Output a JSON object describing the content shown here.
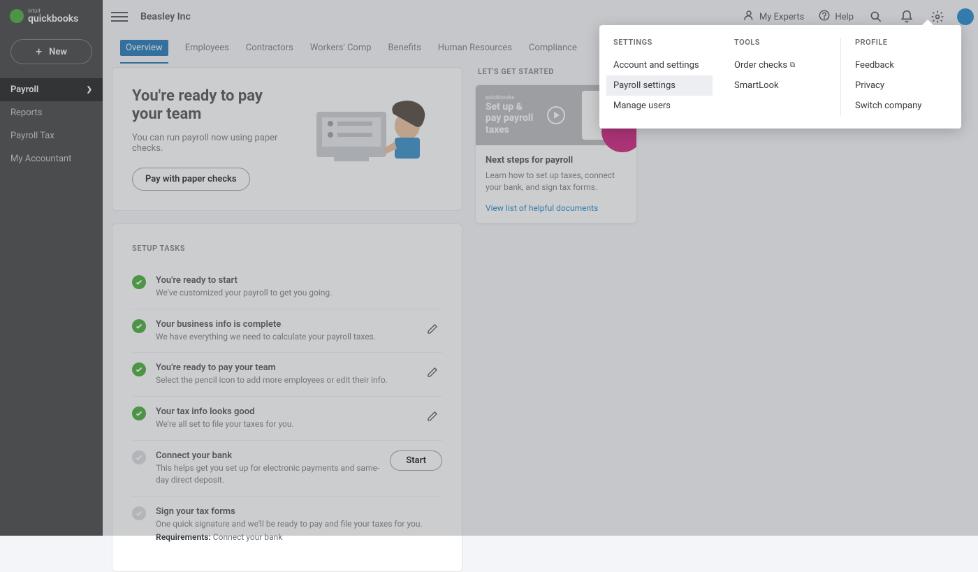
{
  "brand": {
    "main": "quickbooks",
    "sub": "intuit"
  },
  "sidebar": {
    "new_label": "New",
    "items": [
      {
        "label": "Payroll",
        "active": true,
        "has_chevron": true
      },
      {
        "label": "Reports"
      },
      {
        "label": "Payroll Tax"
      },
      {
        "label": "My Accountant"
      }
    ]
  },
  "topbar": {
    "company": "Beasley Inc",
    "experts": "My Experts",
    "help": "Help"
  },
  "tabs": [
    "Overview",
    "Employees",
    "Contractors",
    "Workers' Comp",
    "Benefits",
    "Human Resources",
    "Compliance"
  ],
  "hero": {
    "title_line1": "You're ready to pay",
    "title_line2": "your team",
    "subtitle": "You can run payroll now using paper checks.",
    "button": "Pay with paper checks"
  },
  "setup": {
    "header": "SETUP TASKS",
    "tasks": [
      {
        "done": true,
        "title": "You're ready to start",
        "desc": "We've customized your payroll to get you going.",
        "action": null
      },
      {
        "done": true,
        "title": "Your business info is complete",
        "desc": "We have everything we need to calculate your payroll taxes.",
        "action": "edit"
      },
      {
        "done": true,
        "title": "You're ready to pay your team",
        "desc": "Select the pencil icon to add more employees or edit their info.",
        "action": "edit"
      },
      {
        "done": true,
        "title": "Your tax info looks good",
        "desc": "We're all set to file your taxes for you.",
        "action": "edit"
      },
      {
        "done": false,
        "title": "Connect your bank",
        "desc": "This helps get you set up for electronic payments and same-day direct deposit.",
        "action": "start"
      },
      {
        "done": false,
        "title": "Sign your tax forms",
        "desc": "One quick signature and we'll be ready to pay and file your taxes for you.",
        "action": null,
        "req_label": "Requirements:",
        "req_text": "Connect your bank"
      }
    ],
    "start_label": "Start"
  },
  "getstarted": {
    "header": "LET'S GET STARTED",
    "thumb_brand": "quickbooks",
    "thumb_line1": "Set up &",
    "thumb_line2": "pay payroll",
    "thumb_line3": "taxes",
    "title": "Next steps for payroll",
    "desc": "Learn how to set up taxes, connect your bank, and sign tax forms.",
    "link": "View list of helpful documents"
  },
  "popover": {
    "columns": [
      {
        "header": "SETTINGS",
        "items": [
          {
            "label": "Account and settings"
          },
          {
            "label": "Payroll settings",
            "highlighted": true
          },
          {
            "label": "Manage users"
          }
        ]
      },
      {
        "header": "TOOLS",
        "items": [
          {
            "label": "Order checks",
            "external": true
          },
          {
            "label": "SmartLook"
          }
        ]
      },
      {
        "header": "PROFILE",
        "divider": true,
        "items": [
          {
            "label": "Feedback"
          },
          {
            "label": "Privacy"
          },
          {
            "label": "Switch company"
          }
        ]
      }
    ]
  }
}
